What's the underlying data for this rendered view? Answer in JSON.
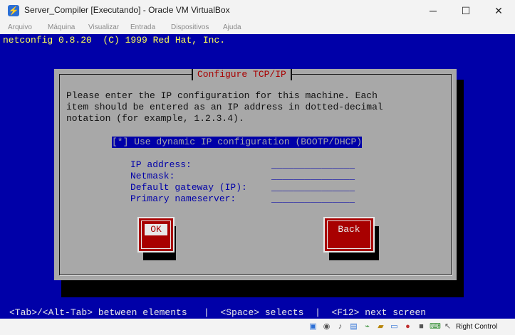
{
  "window": {
    "title": "Server_Compiler [Executando] - Oracle VM VirtualBox",
    "app_icon_glyph": "⚡",
    "minimize_glyph": "─",
    "maximize_glyph": "☐",
    "close_glyph": "✕"
  },
  "menu": [
    "Arquivo",
    "Máquina",
    "Visualizar",
    "Entrada",
    "Dispositivos",
    "Ajuda"
  ],
  "vm_screen": {
    "header": "netconfig 0.8.20  (C) 1999 Red Hat, Inc.",
    "dialog": {
      "title": "Configure TCP/IP",
      "intro_lines": [
        "Please enter the IP configuration for this machine. Each",
        "item should be entered as an IP address in dotted-decimal",
        "notation (for example, 1.2.3.4)."
      ],
      "dhcp_checkbox": "[*] Use dynamic IP configuration (BOOTP/DHCP)",
      "fields": [
        {
          "label": "IP address:",
          "value": "_______________"
        },
        {
          "label": "Netmask:",
          "value": "_______________"
        },
        {
          "label": "Default gateway (IP):",
          "value": "_______________"
        },
        {
          "label": "Primary nameserver:",
          "value": "_______________"
        }
      ],
      "ok_label": "OK",
      "back_label": "Back"
    },
    "status_line": "<Tab>/<Alt-Tab> between elements   |  <Space> selects  |  <F12> next screen"
  },
  "host_statusbar": {
    "right_control": "Right Control",
    "icons": [
      "hard-disk-icon",
      "optical-drive-icon",
      "audio-icon",
      "network-icon",
      "usb-icon",
      "shared-folder-icon",
      "display-icon",
      "recording-icon",
      "cpu-icon",
      "keyboard-capture-icon",
      "mouse-integration-icon"
    ]
  },
  "colors": {
    "vm_background": "#0000a8",
    "dialog_gray": "#a8a8a8",
    "accent_red": "#a80000",
    "text_yellow": "#ffff54",
    "text_white": "#e8e8e8"
  }
}
